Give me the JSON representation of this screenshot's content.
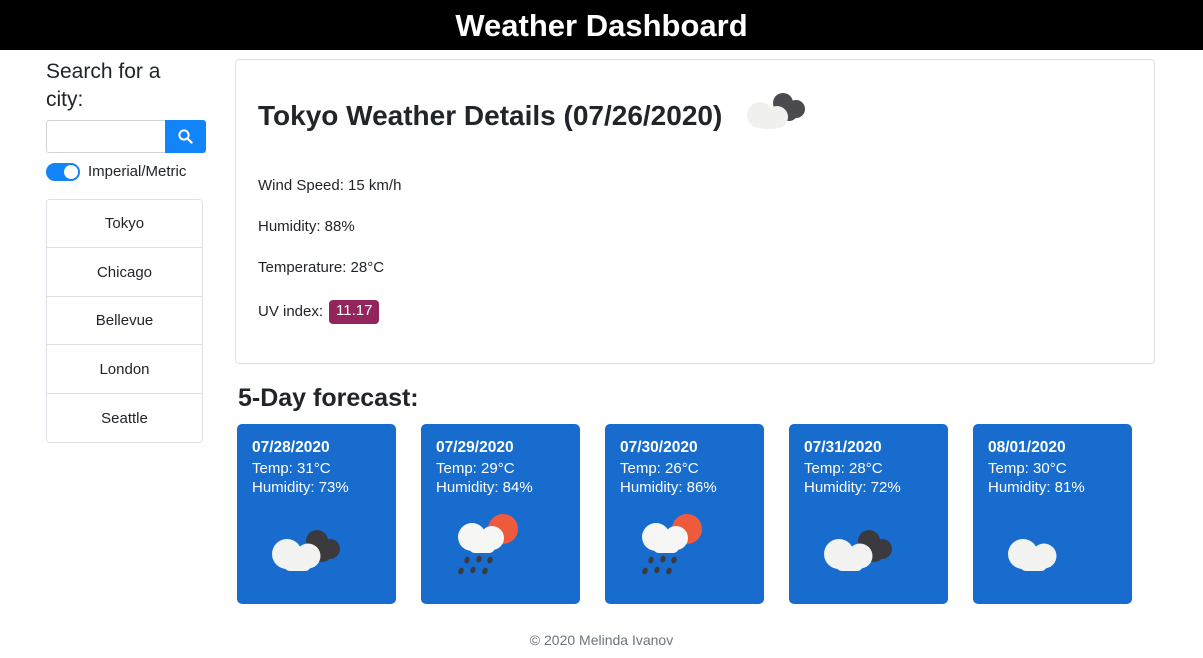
{
  "header": {
    "title": "Weather Dashboard"
  },
  "sidebar": {
    "search_label": "Search for a city:",
    "search_value": "",
    "search_placeholder": "",
    "search_icon": "search-icon",
    "toggle_label": "Imperial/Metric",
    "toggle_on": true,
    "cities": [
      {
        "name": "Tokyo"
      },
      {
        "name": "Chicago"
      },
      {
        "name": "Bellevue"
      },
      {
        "name": "London"
      },
      {
        "name": "Seattle"
      }
    ]
  },
  "details": {
    "title": "Tokyo Weather Details (07/26/2020)",
    "icon": "broken-clouds-icon",
    "wind": "Wind Speed: 15 km/h",
    "humidity": "Humidity: 88%",
    "temperature": "Temperature: 28°C",
    "uv_label": "UV index:",
    "uv_value": "11.17",
    "uv_badge_color": "#91255c"
  },
  "forecast": {
    "heading": "5-Day forecast:",
    "card_color": "#176ccd",
    "days": [
      {
        "date": "07/28/2020",
        "temp": "Temp: 31°C",
        "humidity": "Humidity: 73%",
        "icon": "broken-clouds-icon"
      },
      {
        "date": "07/29/2020",
        "temp": "Temp: 29°C",
        "humidity": "Humidity: 84%",
        "icon": "sun-cloud-rain-icon"
      },
      {
        "date": "07/30/2020",
        "temp": "Temp: 26°C",
        "humidity": "Humidity: 86%",
        "icon": "sun-cloud-rain-icon"
      },
      {
        "date": "07/31/2020",
        "temp": "Temp: 28°C",
        "humidity": "Humidity: 72%",
        "icon": "broken-clouds-icon"
      },
      {
        "date": "08/01/2020",
        "temp": "Temp: 30°C",
        "humidity": "Humidity: 81%",
        "icon": "cloud-icon"
      }
    ]
  },
  "footer": {
    "text": "© 2020 Melinda Ivanov"
  }
}
